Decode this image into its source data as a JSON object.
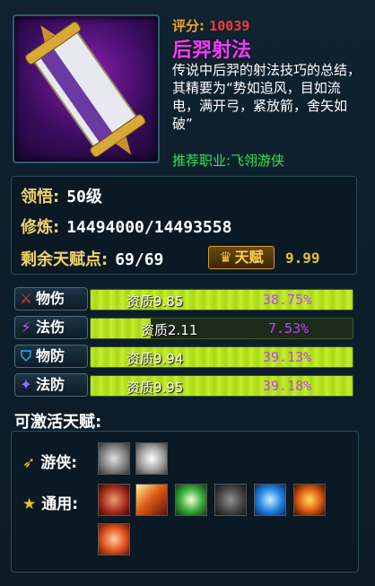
{
  "item": {
    "score_label": "评分:",
    "score_value": "10039",
    "name": "后羿射法",
    "description": "传说中后羿的射法技巧的总结，其精要为“势如追风，目如流电，满开弓，紧放箭，舍矢如破”",
    "recommend": "推荐职业:飞翎游侠"
  },
  "stats": {
    "comprehension_label": "领悟:",
    "comprehension_value": "50级",
    "cultivation_label": "修炼:",
    "cultivation_value": "14494000/14493558",
    "talent_points_label": "剩余天赋点:",
    "talent_points_value": "69/69",
    "talent_button": "天赋",
    "talent_score": "9.99"
  },
  "attributes": [
    {
      "label": "物伤",
      "icon": "sword-icon",
      "quality": "资质9.85",
      "percent": "38.75%",
      "fill": 1.0,
      "color": "#e84040"
    },
    {
      "label": "法伤",
      "icon": "magic-wand-icon",
      "quality": "资质2.11",
      "percent": "7.53%",
      "fill": 0.23,
      "color": "#c050ff"
    },
    {
      "label": "物防",
      "icon": "shield-icon",
      "quality": "资质9.94",
      "percent": "39.13%",
      "fill": 1.0,
      "color": "#30a8e8"
    },
    {
      "label": "法防",
      "icon": "magic-shield-icon",
      "quality": "资质9.95",
      "percent": "39.18%",
      "fill": 1.0,
      "color": "#9070ff"
    }
  ],
  "activatable": {
    "title": "可激活天赋:",
    "ranger_label": "游侠:",
    "general_label": "通用:"
  },
  "colors": {
    "score": "#f2a520",
    "score_value": "#ff3a3a",
    "name": "#e840ff",
    "recommend": "#30e850",
    "bar": "#bfea28",
    "percent": "#c040ff"
  }
}
